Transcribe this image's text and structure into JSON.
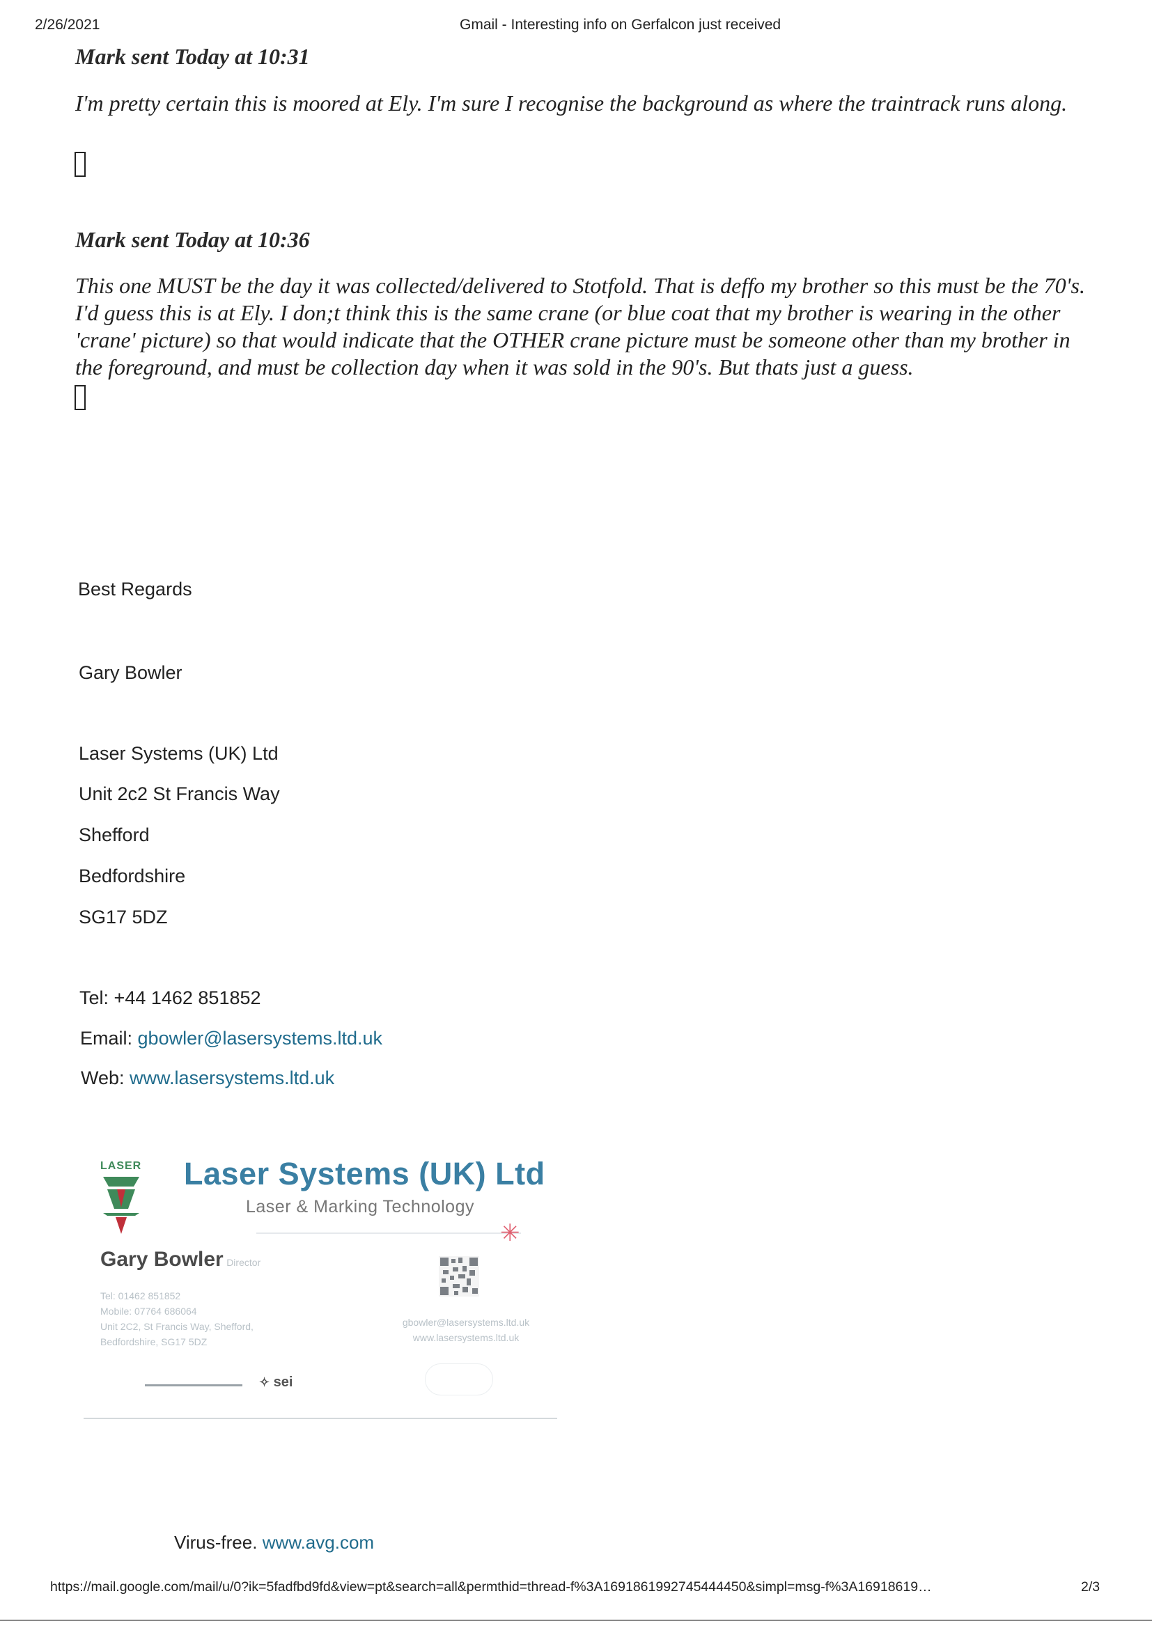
{
  "print_header": {
    "date": "2/26/2021",
    "title": "Gmail - Interesting info on Gerfalcon just received"
  },
  "messages": [
    {
      "sender_line": "Mark sent Today at 10:31",
      "text": "I'm pretty certain this is moored at Ely. I'm sure I recognise the background as where the traintrack runs along."
    },
    {
      "sender_line": "Mark sent Today at 10:36",
      "text": "This one MUST be the day it was collected/delivered to Stotfold. That is deffo my brother so this must be the 70's. I'd guess this is at Ely. I don;t think this is the same crane (or blue coat that my brother is wearing in the other 'crane' picture) so that would indicate that the OTHER crane picture must be someone other than my brother in the foreground, and must be collection day when it was sold in the 90's. But thats just a guess."
    }
  ],
  "signature": {
    "closing": "Best Regards",
    "name": "Gary Bowler",
    "address_lines": [
      "Laser Systems (UK) Ltd",
      "Unit 2c2 St Francis Way",
      "Shefford",
      "Bedfordshire",
      "SG17 5DZ"
    ],
    "tel_label": "Tel:",
    "tel_value": "+44 1462 851852",
    "email_label": "Email:",
    "email_value": "gbowler@lasersystems.ltd.uk",
    "web_label": "Web:",
    "web_value": "www.lasersystems.ltd.uk"
  },
  "business_card": {
    "logo_text": "LASER",
    "company": "Laser Systems (UK) Ltd",
    "tagline": "Laser & Marking Technology",
    "name": "Gary Bowler",
    "role": "Director",
    "details_left": [
      "Tel:     01462 851852",
      "Mobile:  07764 686064",
      "Unit 2C2, St Francis Way, Shefford,",
      "Bedfordshire, SG17 5DZ"
    ],
    "details_right": [
      "gbowler@lasersystems.ltd.uk",
      "www.lasersystems.ltd.uk"
    ],
    "sei_mark": "sei",
    "colors": {
      "brand_blue": "#3a7fa3",
      "logo_green": "#3f8a5a",
      "logo_red": "#c0303a",
      "star_red": "#e06070"
    }
  },
  "virus_free": {
    "label": "Virus-free.",
    "link": "www.avg.com"
  },
  "print_footer": {
    "url": "https://mail.google.com/mail/u/0?ik=5fadfbd9fd&view=pt&search=all&permthid=thread-f%3A1691861992745444450&simpl=msg-f%3A16918619…",
    "page": "2/3"
  }
}
